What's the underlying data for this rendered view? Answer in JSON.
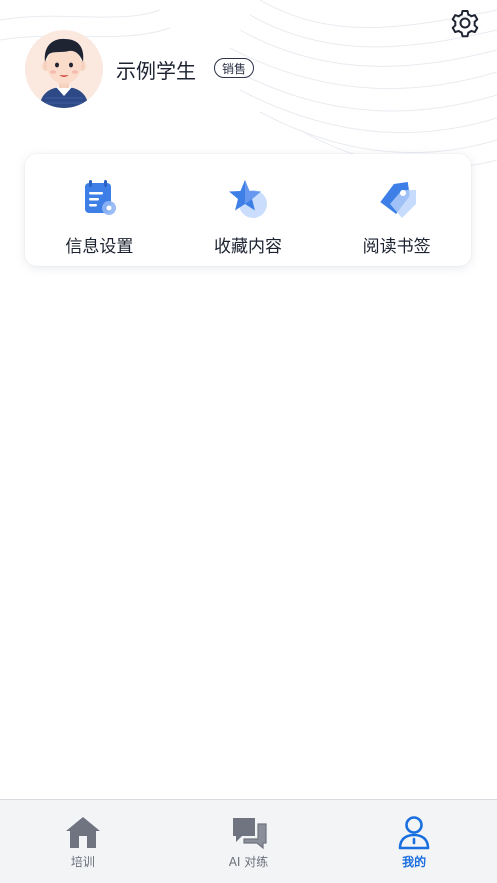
{
  "profile": {
    "name": "示例学生",
    "role_badge": "销售"
  },
  "icons": {
    "settings": "gear-icon",
    "avatar": "student-avatar"
  },
  "quick_menu": [
    {
      "label": "信息设置",
      "icon": "info-settings-icon"
    },
    {
      "label": "收藏内容",
      "icon": "star-icon"
    },
    {
      "label": "阅读书签",
      "icon": "bookmark-tag-icon"
    }
  ],
  "tabbar": {
    "active": 2,
    "tabs": [
      {
        "label": "培训",
        "icon": "home-icon"
      },
      {
        "label": "AI 对练",
        "icon": "chat-icon"
      },
      {
        "label": "我的",
        "icon": "user-icon"
      }
    ]
  },
  "colors": {
    "accent": "#1a6fe0",
    "icon_blue": "#3d7fe6",
    "tab_inactive": "#6a6f7a",
    "avatar_bg": "#fbe8df"
  }
}
